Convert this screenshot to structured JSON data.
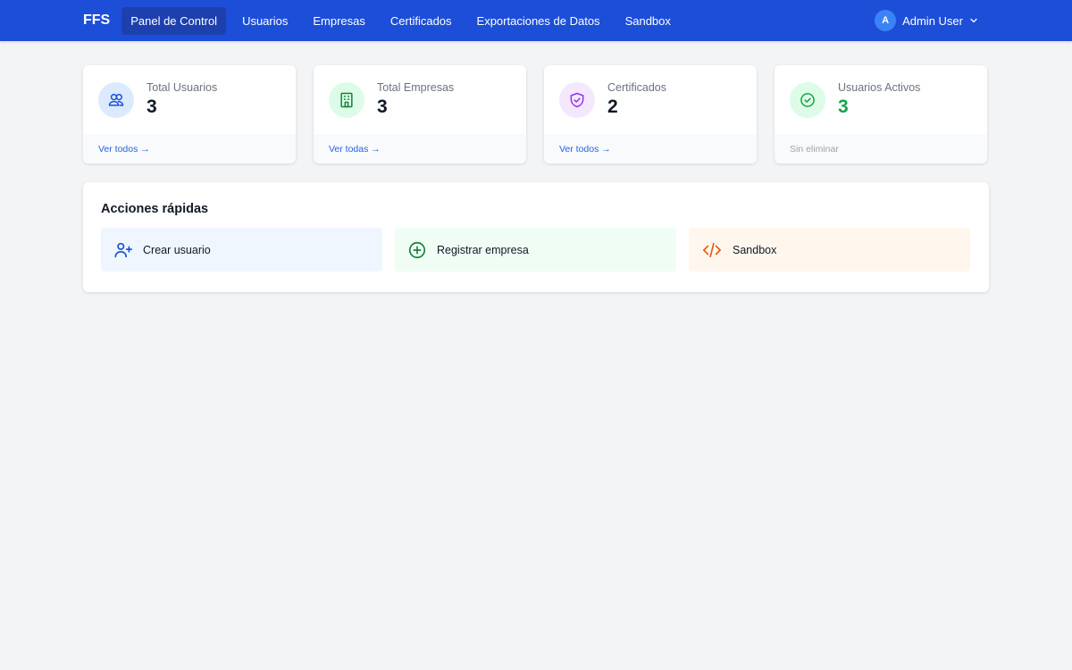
{
  "brand": "FFS",
  "nav": [
    {
      "label": "Panel de Control",
      "active": true
    },
    {
      "label": "Usuarios"
    },
    {
      "label": "Empresas"
    },
    {
      "label": "Certificados"
    },
    {
      "label": "Exportaciones de Datos"
    },
    {
      "label": "Sandbox"
    }
  ],
  "user": {
    "initial": "A",
    "name": "Admin User"
  },
  "stats": [
    {
      "label": "Total Usuarios",
      "value": "3",
      "footer": "Ver todos →",
      "icon": "users-icon",
      "color": "#dbeafe"
    },
    {
      "label": "Total Empresas",
      "value": "3",
      "footer": "Ver todas →",
      "icon": "building-icon",
      "color": "#dcfce7"
    },
    {
      "label": "Certificados",
      "value": "2",
      "footer": "Ver todos →",
      "icon": "shield-check-icon",
      "color": "#f3e8ff"
    },
    {
      "label": "Usuarios Activos",
      "value": "3",
      "footer": "Sin eliminar",
      "icon": "check-circle-icon",
      "color": "#dcfce7"
    }
  ],
  "quick_actions": {
    "title": "Acciones rápidas",
    "items": [
      {
        "label": "Crear usuario",
        "icon": "user-plus-icon",
        "color": "#eff6ff"
      },
      {
        "label": "Registrar empresa",
        "icon": "plus-circle-icon",
        "color": "#f0fdf4"
      },
      {
        "label": "Sandbox",
        "icon": "code-icon",
        "color": "#fff7ed"
      }
    ]
  }
}
